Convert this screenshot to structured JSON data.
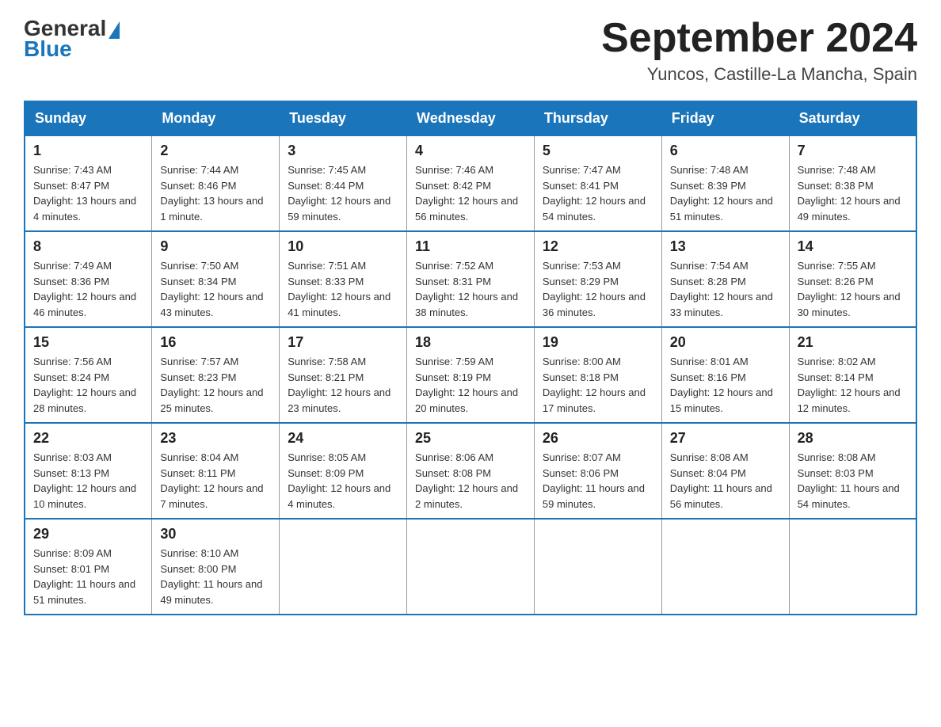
{
  "header": {
    "logo": {
      "general": "General",
      "blue": "Blue"
    },
    "title": "September 2024",
    "location": "Yuncos, Castille-La Mancha, Spain"
  },
  "calendar": {
    "days_of_week": [
      "Sunday",
      "Monday",
      "Tuesday",
      "Wednesday",
      "Thursday",
      "Friday",
      "Saturday"
    ],
    "weeks": [
      [
        {
          "day": "1",
          "sunrise": "Sunrise: 7:43 AM",
          "sunset": "Sunset: 8:47 PM",
          "daylight": "Daylight: 13 hours and 4 minutes."
        },
        {
          "day": "2",
          "sunrise": "Sunrise: 7:44 AM",
          "sunset": "Sunset: 8:46 PM",
          "daylight": "Daylight: 13 hours and 1 minute."
        },
        {
          "day": "3",
          "sunrise": "Sunrise: 7:45 AM",
          "sunset": "Sunset: 8:44 PM",
          "daylight": "Daylight: 12 hours and 59 minutes."
        },
        {
          "day": "4",
          "sunrise": "Sunrise: 7:46 AM",
          "sunset": "Sunset: 8:42 PM",
          "daylight": "Daylight: 12 hours and 56 minutes."
        },
        {
          "day": "5",
          "sunrise": "Sunrise: 7:47 AM",
          "sunset": "Sunset: 8:41 PM",
          "daylight": "Daylight: 12 hours and 54 minutes."
        },
        {
          "day": "6",
          "sunrise": "Sunrise: 7:48 AM",
          "sunset": "Sunset: 8:39 PM",
          "daylight": "Daylight: 12 hours and 51 minutes."
        },
        {
          "day": "7",
          "sunrise": "Sunrise: 7:48 AM",
          "sunset": "Sunset: 8:38 PM",
          "daylight": "Daylight: 12 hours and 49 minutes."
        }
      ],
      [
        {
          "day": "8",
          "sunrise": "Sunrise: 7:49 AM",
          "sunset": "Sunset: 8:36 PM",
          "daylight": "Daylight: 12 hours and 46 minutes."
        },
        {
          "day": "9",
          "sunrise": "Sunrise: 7:50 AM",
          "sunset": "Sunset: 8:34 PM",
          "daylight": "Daylight: 12 hours and 43 minutes."
        },
        {
          "day": "10",
          "sunrise": "Sunrise: 7:51 AM",
          "sunset": "Sunset: 8:33 PM",
          "daylight": "Daylight: 12 hours and 41 minutes."
        },
        {
          "day": "11",
          "sunrise": "Sunrise: 7:52 AM",
          "sunset": "Sunset: 8:31 PM",
          "daylight": "Daylight: 12 hours and 38 minutes."
        },
        {
          "day": "12",
          "sunrise": "Sunrise: 7:53 AM",
          "sunset": "Sunset: 8:29 PM",
          "daylight": "Daylight: 12 hours and 36 minutes."
        },
        {
          "day": "13",
          "sunrise": "Sunrise: 7:54 AM",
          "sunset": "Sunset: 8:28 PM",
          "daylight": "Daylight: 12 hours and 33 minutes."
        },
        {
          "day": "14",
          "sunrise": "Sunrise: 7:55 AM",
          "sunset": "Sunset: 8:26 PM",
          "daylight": "Daylight: 12 hours and 30 minutes."
        }
      ],
      [
        {
          "day": "15",
          "sunrise": "Sunrise: 7:56 AM",
          "sunset": "Sunset: 8:24 PM",
          "daylight": "Daylight: 12 hours and 28 minutes."
        },
        {
          "day": "16",
          "sunrise": "Sunrise: 7:57 AM",
          "sunset": "Sunset: 8:23 PM",
          "daylight": "Daylight: 12 hours and 25 minutes."
        },
        {
          "day": "17",
          "sunrise": "Sunrise: 7:58 AM",
          "sunset": "Sunset: 8:21 PM",
          "daylight": "Daylight: 12 hours and 23 minutes."
        },
        {
          "day": "18",
          "sunrise": "Sunrise: 7:59 AM",
          "sunset": "Sunset: 8:19 PM",
          "daylight": "Daylight: 12 hours and 20 minutes."
        },
        {
          "day": "19",
          "sunrise": "Sunrise: 8:00 AM",
          "sunset": "Sunset: 8:18 PM",
          "daylight": "Daylight: 12 hours and 17 minutes."
        },
        {
          "day": "20",
          "sunrise": "Sunrise: 8:01 AM",
          "sunset": "Sunset: 8:16 PM",
          "daylight": "Daylight: 12 hours and 15 minutes."
        },
        {
          "day": "21",
          "sunrise": "Sunrise: 8:02 AM",
          "sunset": "Sunset: 8:14 PM",
          "daylight": "Daylight: 12 hours and 12 minutes."
        }
      ],
      [
        {
          "day": "22",
          "sunrise": "Sunrise: 8:03 AM",
          "sunset": "Sunset: 8:13 PM",
          "daylight": "Daylight: 12 hours and 10 minutes."
        },
        {
          "day": "23",
          "sunrise": "Sunrise: 8:04 AM",
          "sunset": "Sunset: 8:11 PM",
          "daylight": "Daylight: 12 hours and 7 minutes."
        },
        {
          "day": "24",
          "sunrise": "Sunrise: 8:05 AM",
          "sunset": "Sunset: 8:09 PM",
          "daylight": "Daylight: 12 hours and 4 minutes."
        },
        {
          "day": "25",
          "sunrise": "Sunrise: 8:06 AM",
          "sunset": "Sunset: 8:08 PM",
          "daylight": "Daylight: 12 hours and 2 minutes."
        },
        {
          "day": "26",
          "sunrise": "Sunrise: 8:07 AM",
          "sunset": "Sunset: 8:06 PM",
          "daylight": "Daylight: 11 hours and 59 minutes."
        },
        {
          "day": "27",
          "sunrise": "Sunrise: 8:08 AM",
          "sunset": "Sunset: 8:04 PM",
          "daylight": "Daylight: 11 hours and 56 minutes."
        },
        {
          "day": "28",
          "sunrise": "Sunrise: 8:08 AM",
          "sunset": "Sunset: 8:03 PM",
          "daylight": "Daylight: 11 hours and 54 minutes."
        }
      ],
      [
        {
          "day": "29",
          "sunrise": "Sunrise: 8:09 AM",
          "sunset": "Sunset: 8:01 PM",
          "daylight": "Daylight: 11 hours and 51 minutes."
        },
        {
          "day": "30",
          "sunrise": "Sunrise: 8:10 AM",
          "sunset": "Sunset: 8:00 PM",
          "daylight": "Daylight: 11 hours and 49 minutes."
        },
        null,
        null,
        null,
        null,
        null
      ]
    ]
  }
}
